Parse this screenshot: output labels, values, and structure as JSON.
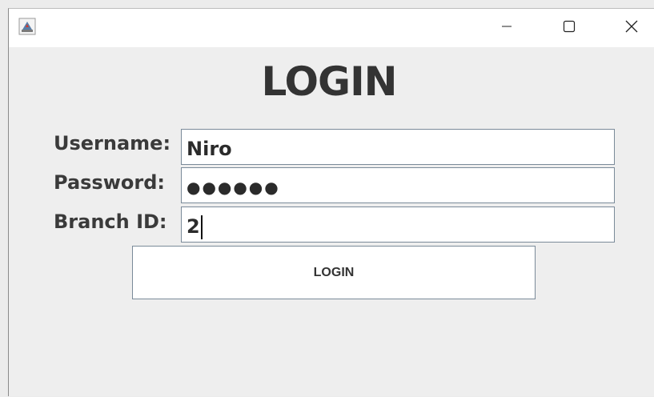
{
  "window": {
    "icons": {
      "app": "java-cup-icon",
      "minimize": "minimize-icon",
      "maximize": "maximize-icon",
      "close": "close-icon"
    }
  },
  "form": {
    "heading": "LOGIN",
    "username_label": "Username:",
    "username_value": "Niro",
    "password_label": "Password:",
    "password_masked": "●●●●●●",
    "branch_label": "Branch ID:",
    "branch_value": "2",
    "submit_label": "LOGIN"
  }
}
